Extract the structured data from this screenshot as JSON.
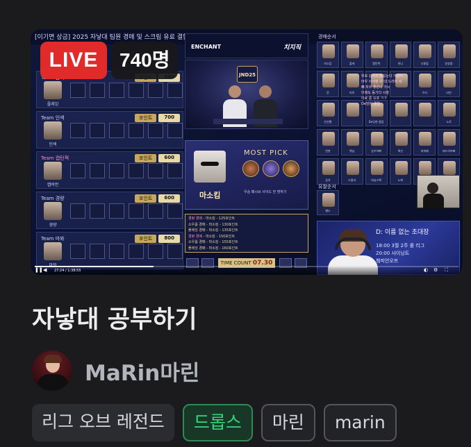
{
  "thumbnail": {
    "top_strip_text": "[이기면 상금] 2025 자낳대 팀원 경매 및 스크림 유료 결합",
    "live_label": "LIVE",
    "viewers": "740명",
    "overlay": {
      "sponsor_left": "ENCHANT",
      "sponsor_right": "치지직",
      "event_logo": "JND25",
      "most_pick_title": "MOST PICK",
      "most_pick_player": "마소킴",
      "most_pick_note": "우승 패시브 사이드 한 명하기",
      "points_label": "포인트",
      "teams": [
        {
          "name": "Team 삼식",
          "points": "800",
          "player": "플레잉",
          "pink": false
        },
        {
          "name": "Team 인섹",
          "points": "700",
          "player": "인섹",
          "pink": false
        },
        {
          "name": "Team 캡틴잭",
          "points": "600",
          "player": "캡비번",
          "pink": true
        },
        {
          "name": "Team 경량",
          "points": "600",
          "player": "경량",
          "pink": false
        },
        {
          "name": "Team 마뫄",
          "points": "800",
          "player": "마뫄",
          "pink": false
        }
      ],
      "bid_log": [
        {
          "team": "경량 경매",
          "text": " - 마소킴 - 125포인트"
        },
        {
          "team": "소우룹 경매",
          "text": " - 마소킴 - 130포인트"
        },
        {
          "team": "플레잉 경매",
          "text": " - 마소킴 - 135포인트"
        },
        {
          "team": "경량 경매",
          "text": " - 마소킴 - 150포인트"
        },
        {
          "team": "소우룹 경매",
          "text": " - 마소킴 - 155포인트"
        },
        {
          "team": "플레잉 경매",
          "text": " - 마소킴 - 160포인트"
        }
      ],
      "time_count_label": "TIME COUNT",
      "time_count_value": "07.30",
      "auction_order_label": "경매순서",
      "fail_order_label": "유찰순서",
      "grid_names": [
        "마소킴",
        "플레",
        "캡틴잭",
        "뮤니",
        "너클럽",
        "방송중",
        "문",
        "미로",
        "",
        "",
        "우리",
        "리빈",
        "안산행",
        "",
        "De당현 클럽",
        "",
        "",
        "노로",
        "안현",
        "햇님",
        "승우아빠",
        "록산",
        "마피떼",
        "테드의아빠",
        "공히",
        "드졸라",
        "마닐스팩",
        "노에",
        "고수람",
        ""
      ],
      "fail_name": "별소",
      "chat_lines": [
        "위로 김서서 잘있는다 거있어",
        "마우 아세영 이 대 드려이 대",
        "빼 자꾸  좋은다 가시",
        "이래도 동기다 시청",
        "미로 중 오프 ㅋㅋ",
        "De당현 클럽"
      ],
      "promo_headline": "D: 이름 없는 초대장",
      "promo_rows": [
        "18:00   3월 2주 롤 리그",
        "20:00   샤이닝트",
        "         챔피언오프"
      ],
      "player_time": "27:24 / 1:38:55",
      "progress": 0.28
    }
  },
  "stream": {
    "title": "자낳대 공부하기",
    "channel_name": "MaRin마린"
  },
  "tags": [
    {
      "label": "리그 오브 레전드",
      "style": "plain"
    },
    {
      "label": "드롭스",
      "style": "green"
    },
    {
      "label": "마린",
      "style": "outline"
    },
    {
      "label": "marin",
      "style": "outline"
    }
  ],
  "colors": {
    "background": "#1b1b1e",
    "live": "#e12a2a",
    "drops_green": "#36d67c",
    "channel_name": "#b3b4bc"
  }
}
